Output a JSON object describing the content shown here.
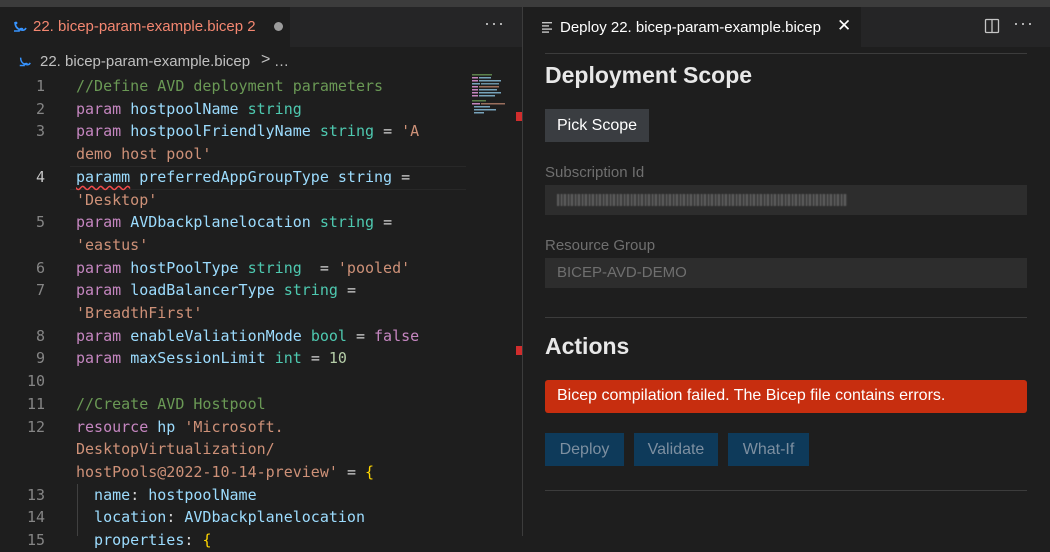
{
  "editor": {
    "tab": {
      "title": "22. bicep-param-example.bicep",
      "problems": "2"
    },
    "breadcrumb": {
      "file": "22. bicep-param-example.bicep",
      "separator": ">",
      "more": "…"
    },
    "lines": [
      {
        "num": "1",
        "tokens": [
          {
            "t": "//Define AVD deployment parameters",
            "c": "cmt"
          }
        ]
      },
      {
        "num": "2",
        "tokens": [
          {
            "t": "param ",
            "c": "kw"
          },
          {
            "t": "hostpoolName ",
            "c": "id"
          },
          {
            "t": "string",
            "c": "ty"
          }
        ]
      },
      {
        "num": "3",
        "tokens": [
          {
            "t": "param ",
            "c": "kw"
          },
          {
            "t": "hostpoolFriendlyName ",
            "c": "id"
          },
          {
            "t": "string ",
            "c": "ty"
          },
          {
            "t": "= ",
            "c": "op"
          },
          {
            "t": "'A",
            "c": "str"
          }
        ]
      },
      {
        "num": "",
        "tokens": [
          {
            "t": "demo host pool'",
            "c": "str"
          }
        ]
      },
      {
        "num": "4",
        "tokens": [
          {
            "t": "paramm",
            "c": "id squig"
          },
          {
            "t": " preferredAppGroupType ",
            "c": "id"
          },
          {
            "t": "string ",
            "c": "id"
          },
          {
            "t": "=",
            "c": "op"
          }
        ]
      },
      {
        "num": "",
        "tokens": [
          {
            "t": "'Desktop'",
            "c": "str"
          }
        ]
      },
      {
        "num": "5",
        "tokens": [
          {
            "t": "param ",
            "c": "kw"
          },
          {
            "t": "AVDbackplanelocation ",
            "c": "id"
          },
          {
            "t": "string ",
            "c": "ty"
          },
          {
            "t": "=",
            "c": "op"
          }
        ]
      },
      {
        "num": "",
        "tokens": [
          {
            "t": "'eastus'",
            "c": "str"
          }
        ]
      },
      {
        "num": "6",
        "tokens": [
          {
            "t": "param ",
            "c": "kw"
          },
          {
            "t": "hostPoolType ",
            "c": "id"
          },
          {
            "t": "string  ",
            "c": "ty"
          },
          {
            "t": "= ",
            "c": "op"
          },
          {
            "t": "'pooled'",
            "c": "str"
          }
        ]
      },
      {
        "num": "7",
        "tokens": [
          {
            "t": "param ",
            "c": "kw"
          },
          {
            "t": "loadBalancerType ",
            "c": "id"
          },
          {
            "t": "string ",
            "c": "ty"
          },
          {
            "t": "=",
            "c": "op"
          }
        ]
      },
      {
        "num": "",
        "tokens": [
          {
            "t": "'BreadthFirst'",
            "c": "str"
          }
        ]
      },
      {
        "num": "8",
        "tokens": [
          {
            "t": "param ",
            "c": "kw"
          },
          {
            "t": "enableValiationMode ",
            "c": "id"
          },
          {
            "t": "bool ",
            "c": "ty"
          },
          {
            "t": "= ",
            "c": "op"
          },
          {
            "t": "false",
            "c": "kw"
          }
        ]
      },
      {
        "num": "9",
        "tokens": [
          {
            "t": "param ",
            "c": "kw"
          },
          {
            "t": "maxSessionLimit ",
            "c": "id"
          },
          {
            "t": "int ",
            "c": "ty"
          },
          {
            "t": "= ",
            "c": "op"
          },
          {
            "t": "10",
            "c": "num"
          }
        ]
      },
      {
        "num": "10",
        "tokens": []
      },
      {
        "num": "11",
        "tokens": [
          {
            "t": "//Create AVD Hostpool",
            "c": "cmt"
          }
        ]
      },
      {
        "num": "12",
        "tokens": [
          {
            "t": "resource ",
            "c": "kw"
          },
          {
            "t": "hp ",
            "c": "id"
          },
          {
            "t": "'Microsoft.",
            "c": "str"
          }
        ]
      },
      {
        "num": "",
        "tokens": [
          {
            "t": "DesktopVirtualization/",
            "c": "str"
          }
        ]
      },
      {
        "num": "",
        "tokens": [
          {
            "t": "hostPools@2022-10-14-preview' ",
            "c": "str"
          },
          {
            "t": "= ",
            "c": "op"
          },
          {
            "t": "{",
            "c": "br"
          }
        ]
      },
      {
        "num": "13",
        "tokens": [
          {
            "t": "  name",
            "c": "id"
          },
          {
            "t": ": ",
            "c": "op"
          },
          {
            "t": "hostpoolName",
            "c": "id"
          }
        ]
      },
      {
        "num": "14",
        "tokens": [
          {
            "t": "  location",
            "c": "id"
          },
          {
            "t": ": ",
            "c": "op"
          },
          {
            "t": "AVDbackplanelocation",
            "c": "id"
          }
        ]
      },
      {
        "num": "15",
        "tokens": [
          {
            "t": "  properties",
            "c": "id"
          },
          {
            "t": ": ",
            "c": "op"
          },
          {
            "t": "{",
            "c": "br"
          }
        ]
      }
    ],
    "current_line": "4"
  },
  "panel": {
    "tab_title": "Deploy 22. bicep-param-example.bicep",
    "scope_heading": "Deployment Scope",
    "pick_scope_label": "Pick Scope",
    "subscription_label": "Subscription Id",
    "subscription_value": "",
    "resource_group_label": "Resource Group",
    "resource_group_value": "BICEP-AVD-DEMO",
    "actions_heading": "Actions",
    "error_message": "Bicep compilation failed. The Bicep file contains errors.",
    "buttons": {
      "deploy": "Deploy",
      "validate": "Validate",
      "whatif": "What-If"
    }
  },
  "colors": {
    "error_banner": "#c72e0f",
    "action_button_bg": "#0e3a5a",
    "tab_modified_text": "#f48771"
  },
  "icons": [
    "bicep-file-icon",
    "more-actions-icon",
    "preview-icon",
    "close-icon",
    "split-editor-icon",
    "modified-dot-icon"
  ]
}
